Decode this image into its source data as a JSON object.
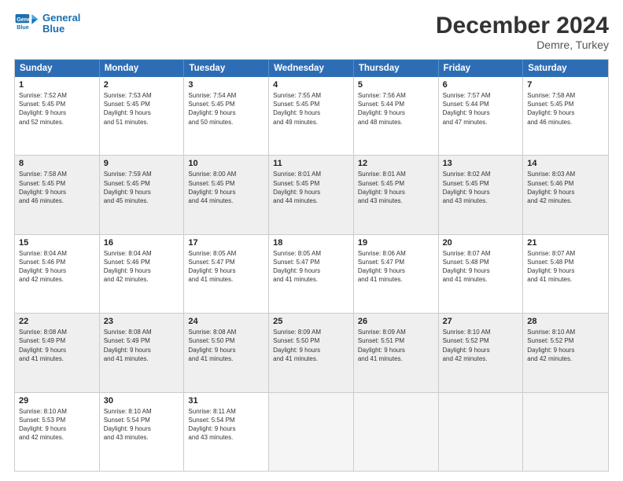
{
  "logo": {
    "line1": "General",
    "line2": "Blue"
  },
  "title": "December 2024",
  "subtitle": "Demre, Turkey",
  "days": [
    "Sunday",
    "Monday",
    "Tuesday",
    "Wednesday",
    "Thursday",
    "Friday",
    "Saturday"
  ],
  "weeks": [
    [
      {
        "day": "1",
        "sunrise": "7:52 AM",
        "sunset": "5:45 PM",
        "daylight": "9 hours and 52 minutes."
      },
      {
        "day": "2",
        "sunrise": "7:53 AM",
        "sunset": "5:45 PM",
        "daylight": "9 hours and 51 minutes."
      },
      {
        "day": "3",
        "sunrise": "7:54 AM",
        "sunset": "5:45 PM",
        "daylight": "9 hours and 50 minutes."
      },
      {
        "day": "4",
        "sunrise": "7:55 AM",
        "sunset": "5:45 PM",
        "daylight": "9 hours and 49 minutes."
      },
      {
        "day": "5",
        "sunrise": "7:56 AM",
        "sunset": "5:44 PM",
        "daylight": "9 hours and 48 minutes."
      },
      {
        "day": "6",
        "sunrise": "7:57 AM",
        "sunset": "5:44 PM",
        "daylight": "9 hours and 47 minutes."
      },
      {
        "day": "7",
        "sunrise": "7:58 AM",
        "sunset": "5:45 PM",
        "daylight": "9 hours and 46 minutes."
      }
    ],
    [
      {
        "day": "8",
        "sunrise": "7:58 AM",
        "sunset": "5:45 PM",
        "daylight": "9 hours and 46 minutes."
      },
      {
        "day": "9",
        "sunrise": "7:59 AM",
        "sunset": "5:45 PM",
        "daylight": "9 hours and 45 minutes."
      },
      {
        "day": "10",
        "sunrise": "8:00 AM",
        "sunset": "5:45 PM",
        "daylight": "9 hours and 44 minutes."
      },
      {
        "day": "11",
        "sunrise": "8:01 AM",
        "sunset": "5:45 PM",
        "daylight": "9 hours and 44 minutes."
      },
      {
        "day": "12",
        "sunrise": "8:01 AM",
        "sunset": "5:45 PM",
        "daylight": "9 hours and 43 minutes."
      },
      {
        "day": "13",
        "sunrise": "8:02 AM",
        "sunset": "5:45 PM",
        "daylight": "9 hours and 43 minutes."
      },
      {
        "day": "14",
        "sunrise": "8:03 AM",
        "sunset": "5:46 PM",
        "daylight": "9 hours and 42 minutes."
      }
    ],
    [
      {
        "day": "15",
        "sunrise": "8:04 AM",
        "sunset": "5:46 PM",
        "daylight": "9 hours and 42 minutes."
      },
      {
        "day": "16",
        "sunrise": "8:04 AM",
        "sunset": "5:46 PM",
        "daylight": "9 hours and 42 minutes."
      },
      {
        "day": "17",
        "sunrise": "8:05 AM",
        "sunset": "5:47 PM",
        "daylight": "9 hours and 41 minutes."
      },
      {
        "day": "18",
        "sunrise": "8:05 AM",
        "sunset": "5:47 PM",
        "daylight": "9 hours and 41 minutes."
      },
      {
        "day": "19",
        "sunrise": "8:06 AM",
        "sunset": "5:47 PM",
        "daylight": "9 hours and 41 minutes."
      },
      {
        "day": "20",
        "sunrise": "8:07 AM",
        "sunset": "5:48 PM",
        "daylight": "9 hours and 41 minutes."
      },
      {
        "day": "21",
        "sunrise": "8:07 AM",
        "sunset": "5:48 PM",
        "daylight": "9 hours and 41 minutes."
      }
    ],
    [
      {
        "day": "22",
        "sunrise": "8:08 AM",
        "sunset": "5:49 PM",
        "daylight": "9 hours and 41 minutes."
      },
      {
        "day": "23",
        "sunrise": "8:08 AM",
        "sunset": "5:49 PM",
        "daylight": "9 hours and 41 minutes."
      },
      {
        "day": "24",
        "sunrise": "8:08 AM",
        "sunset": "5:50 PM",
        "daylight": "9 hours and 41 minutes."
      },
      {
        "day": "25",
        "sunrise": "8:09 AM",
        "sunset": "5:50 PM",
        "daylight": "9 hours and 41 minutes."
      },
      {
        "day": "26",
        "sunrise": "8:09 AM",
        "sunset": "5:51 PM",
        "daylight": "9 hours and 41 minutes."
      },
      {
        "day": "27",
        "sunrise": "8:10 AM",
        "sunset": "5:52 PM",
        "daylight": "9 hours and 42 minutes."
      },
      {
        "day": "28",
        "sunrise": "8:10 AM",
        "sunset": "5:52 PM",
        "daylight": "9 hours and 42 minutes."
      }
    ],
    [
      {
        "day": "29",
        "sunrise": "8:10 AM",
        "sunset": "5:53 PM",
        "daylight": "9 hours and 42 minutes."
      },
      {
        "day": "30",
        "sunrise": "8:10 AM",
        "sunset": "5:54 PM",
        "daylight": "9 hours and 43 minutes."
      },
      {
        "day": "31",
        "sunrise": "8:11 AM",
        "sunset": "5:54 PM",
        "daylight": "9 hours and 43 minutes."
      },
      null,
      null,
      null,
      null
    ]
  ]
}
